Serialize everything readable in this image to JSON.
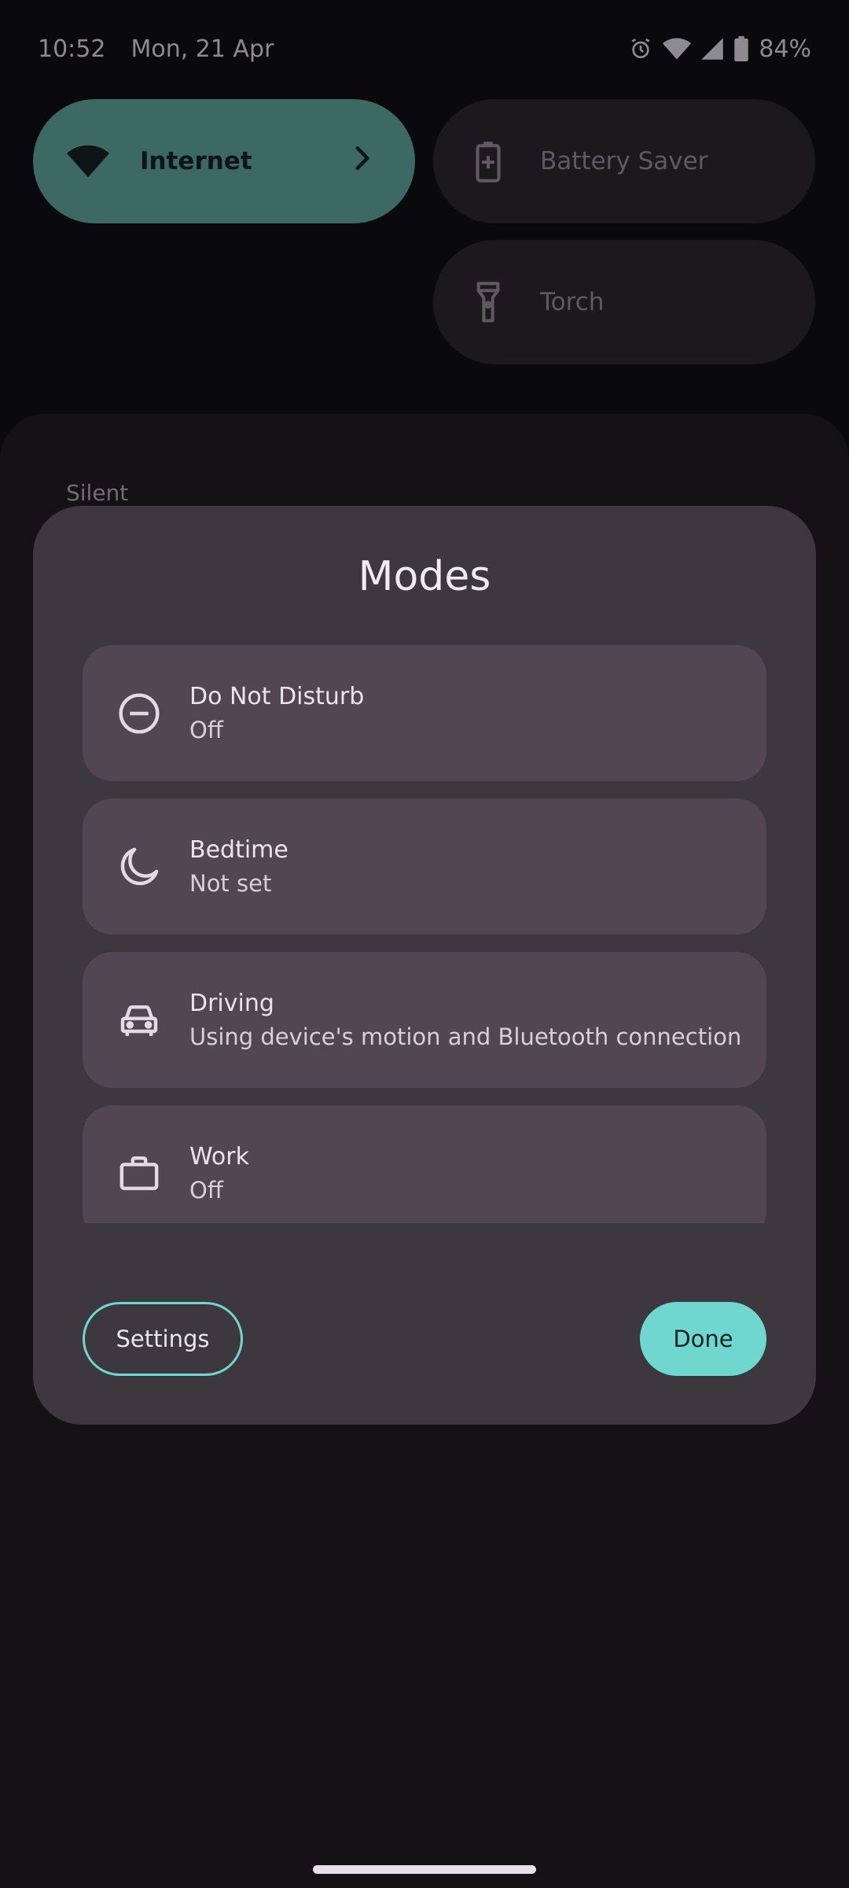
{
  "status_bar": {
    "time": "10:52",
    "date": "Mon, 21 Apr",
    "battery": "84%",
    "icons": [
      "alarm-icon",
      "wifi-icon",
      "signal-icon",
      "battery-icon"
    ]
  },
  "quick_settings": {
    "tiles": [
      {
        "label": "Internet",
        "icon": "wifi-icon",
        "active": true
      },
      {
        "label": "Battery Saver",
        "icon": "battery-saver-icon",
        "active": false
      },
      {
        "label": "Torch",
        "icon": "torch-icon",
        "active": false
      }
    ]
  },
  "shade": {
    "section_label": "Silent"
  },
  "modes_dialog": {
    "title": "Modes",
    "modes": [
      {
        "name": "Do Not Disturb",
        "status": "Off",
        "icon": "do-not-disturb-icon"
      },
      {
        "name": "Bedtime",
        "status": "Not set",
        "icon": "moon-icon"
      },
      {
        "name": "Driving",
        "status": "Using device's motion and Bluetooth connection",
        "icon": "car-icon"
      },
      {
        "name": "Work",
        "status": "Off",
        "icon": "briefcase-icon"
      }
    ],
    "settings_label": "Settings",
    "done_label": "Done"
  },
  "colors": {
    "accent": "#6fd6d0",
    "internet_tile": "#3d6964",
    "dialog_bg": "#3d383e",
    "mode_card_bg": "#514652"
  }
}
